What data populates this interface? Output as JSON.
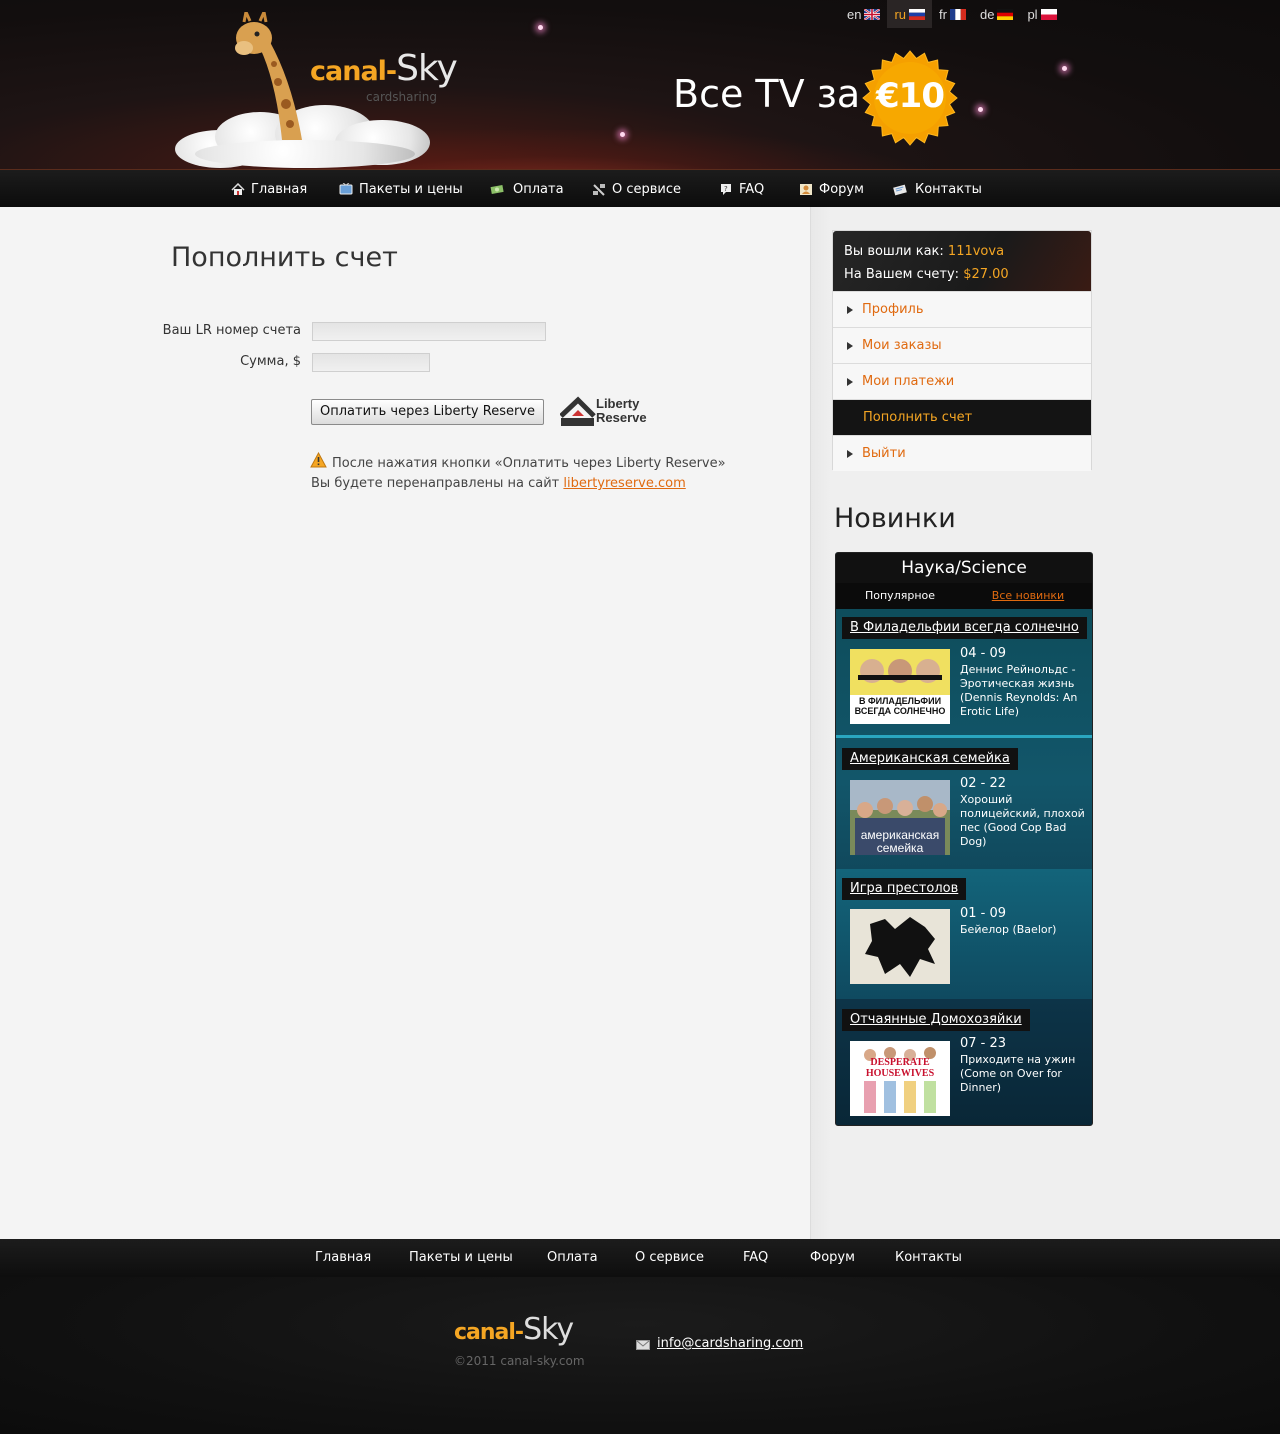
{
  "header": {
    "logo_brand": "canal-",
    "logo_sky": "Sky",
    "logo_sub": "cardsharing",
    "promo": "Все TV за",
    "badge": "€10",
    "languages": [
      {
        "code": "en",
        "flag": "uk-flag-icon"
      },
      {
        "code": "ru",
        "flag": "russia-flag-icon",
        "active": true
      },
      {
        "code": "fr",
        "flag": "france-flag-icon"
      },
      {
        "code": "de",
        "flag": "germany-flag-icon"
      },
      {
        "code": "pl",
        "flag": "poland-flag-icon"
      }
    ]
  },
  "nav": {
    "items": [
      {
        "label": "Главная",
        "icon": "home-icon"
      },
      {
        "label": "Пакеты и цены",
        "icon": "tv-icon"
      },
      {
        "label": "Оплата",
        "icon": "money-icon"
      },
      {
        "label": "О сервисе",
        "icon": "satellite-icon"
      },
      {
        "label": "FAQ",
        "icon": "question-icon"
      },
      {
        "label": "Форум",
        "icon": "forum-icon"
      },
      {
        "label": "Контакты",
        "icon": "contacts-icon"
      }
    ]
  },
  "main": {
    "title": "Пополнить счет",
    "form": {
      "lr_label": "Ваш LR номер счета",
      "lr_value": "",
      "sum_label": "Сумма, $",
      "sum_value": "",
      "pay_button": "Оплатить через Liberty Reserve"
    },
    "lr_logo_line1": "Liberty",
    "lr_logo_line2": "Reserve",
    "note_line1": "После нажатия кнопки «Оплатить через Liberty Reserve»",
    "note_line2_prefix": "Вы будете перенаправлены на сайт ",
    "note_link": "libertyreserve.com"
  },
  "account": {
    "logged_label": "Вы вошли как:",
    "username": "111vova",
    "balance_label": "На Вашем счету:",
    "balance": "$27.00",
    "menu": [
      {
        "label": "Профиль"
      },
      {
        "label": "Мои заказы"
      },
      {
        "label": "Мои платежи"
      },
      {
        "label": "Пополнить счет",
        "active": true
      },
      {
        "label": "Выйти"
      }
    ]
  },
  "news": {
    "title": "Новинки",
    "category": "Наука/Science",
    "tab_popular": "Популярное",
    "tab_all": "Все новинки",
    "shows": [
      {
        "title": "В Филадельфии всегда солнечно",
        "episode": "04 - 09",
        "desc": "Деннис Рейнольдс - Эротическая жизнь (Dennis Reynolds: An Erotic Life)",
        "thumb_text": "В ФИЛАДЕЛЬФИИ ВСЕГДА СОЛНЕЧНО"
      },
      {
        "title": "Американская семейка",
        "episode": "02 - 22",
        "desc": "Хороший полицейский, плохой пес (Good Cop Bad Dog)",
        "thumb_text": "американская семейка"
      },
      {
        "title": "Игра престолов",
        "episode": "01 - 09",
        "desc": "Бейелор (Baelor)",
        "thumb_text": ""
      },
      {
        "title": "Отчаянные Домохозяйки",
        "episode": "07 - 23",
        "desc": "Приходите на ужин (Come on Over for Dinner)",
        "thumb_text": "DESPERATE HOUSEWIVES"
      }
    ]
  },
  "footer": {
    "nav": [
      "Главная",
      "Пакеты и цены",
      "Оплата",
      "О сервисе",
      "FAQ",
      "Форум",
      "Контакты"
    ],
    "logo_brand": "canal-",
    "logo_sky": "Sky",
    "copyright": "©2011 canal-sky.com",
    "email": "info@cardsharing.com"
  },
  "colors": {
    "accent": "#e06a10",
    "gold": "#f5a623",
    "dark": "#111111"
  }
}
